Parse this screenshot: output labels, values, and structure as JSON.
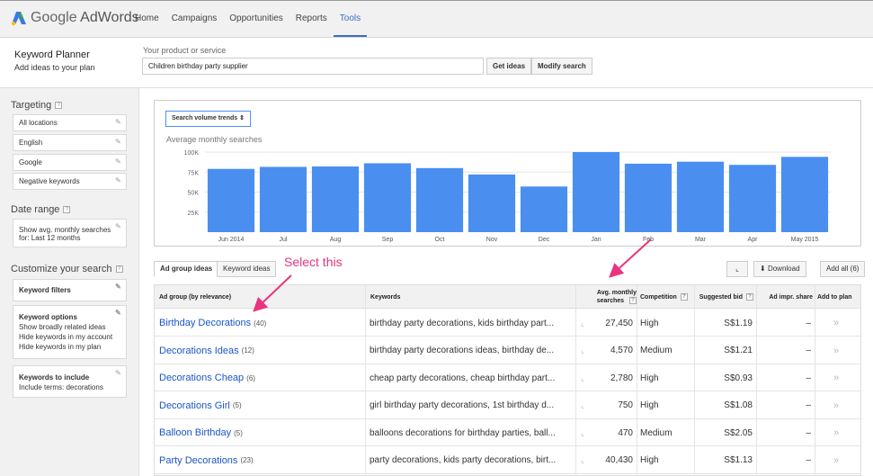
{
  "app": {
    "logo_word1": "Google",
    "logo_word2": "AdWords"
  },
  "nav": [
    {
      "label": "Home"
    },
    {
      "label": "Campaigns"
    },
    {
      "label": "Opportunities"
    },
    {
      "label": "Reports"
    },
    {
      "label": "Tools"
    }
  ],
  "header": {
    "title": "Keyword Planner",
    "subtitle": "Add ideas to your plan",
    "product_label": "Your product or service",
    "product_value": "Children birthday party supplier",
    "get_ideas": "Get ideas",
    "modify_search": "Modify search"
  },
  "sidebar": {
    "targeting_title": "Targeting",
    "targeting": [
      "All locations",
      "English",
      "Google",
      "Negative keywords"
    ],
    "date_title": "Date range",
    "date_line1": "Show avg. monthly searches",
    "date_line2": "for: Last 12 months",
    "customize_title": "Customize your search",
    "keyword_filters": "Keyword filters",
    "keyword_options_title": "Keyword options",
    "keyword_options": [
      "Show broadly related ideas",
      "Hide keywords in my account",
      "Hide keywords in my plan"
    ],
    "include_title": "Keywords to include",
    "include_value": "Include terms: decorations"
  },
  "chart_panel": {
    "select_label": "Search volume trends",
    "subtitle": "Average monthly searches"
  },
  "chart_data": {
    "type": "bar",
    "categories": [
      "Jun 2014",
      "Jul",
      "Aug",
      "Sep",
      "Oct",
      "Nov",
      "Dec",
      "Jan",
      "Feb",
      "Mar",
      "Apr",
      "May 2015"
    ],
    "values": [
      79000,
      81500,
      82000,
      86000,
      80000,
      72000,
      57000,
      100000,
      85500,
      88000,
      84000,
      94000
    ],
    "yticks": [
      "25K",
      "50K",
      "75K",
      "100K"
    ],
    "ytick_values": [
      25000,
      50000,
      75000,
      100000
    ],
    "ylim": [
      0,
      100000
    ],
    "bar_color": "#4a8ff0",
    "grid": true
  },
  "tabs": {
    "ad_group": "Ad group ideas",
    "keyword": "Keyword ideas"
  },
  "actions": {
    "download": "Download",
    "add_all": "Add all (6)"
  },
  "table": {
    "headers": {
      "ad_group": "Ad group (by relevance)",
      "keywords": "Keywords",
      "avg_line1": "Avg. monthly",
      "avg_line2": "searches",
      "competition": "Competition",
      "bid": "Suggested bid",
      "impr": "Ad impr. share",
      "add": "Add to plan"
    },
    "rows": [
      {
        "group": "Birthday Decorations",
        "count": "(40)",
        "keywords": "birthday party decorations, kids birthday part...",
        "searches": "27,450",
        "competition": "High",
        "bid": "S$1.19",
        "impr": "–"
      },
      {
        "group": "Decorations Ideas",
        "count": "(12)",
        "keywords": "birthday party decorations ideas, birthday de...",
        "searches": "4,570",
        "competition": "Medium",
        "bid": "S$1.21",
        "impr": "–"
      },
      {
        "group": "Decorations Cheap",
        "count": "(6)",
        "keywords": "cheap party decorations, cheap birthday part...",
        "searches": "2,780",
        "competition": "High",
        "bid": "S$0.93",
        "impr": "–"
      },
      {
        "group": "Decorations Girl",
        "count": "(5)",
        "keywords": "girl birthday party decorations, 1st birthday d...",
        "searches": "750",
        "competition": "High",
        "bid": "S$1.08",
        "impr": "–"
      },
      {
        "group": "Balloon Birthday",
        "count": "(5)",
        "keywords": "balloons decorations for birthday parties, ball...",
        "searches": "470",
        "competition": "Medium",
        "bid": "S$2.05",
        "impr": "–"
      },
      {
        "group": "Party Decorations",
        "count": "(23)",
        "keywords": "party decorations, kids party decorations, birt...",
        "searches": "40,430",
        "competition": "High",
        "bid": "S$1.13",
        "impr": "–"
      }
    ]
  },
  "annotation": {
    "text": "Select this"
  },
  "colors": {
    "accent": "#3b6dc3",
    "link": "#1a55c8",
    "annotation": "#e8357e"
  }
}
